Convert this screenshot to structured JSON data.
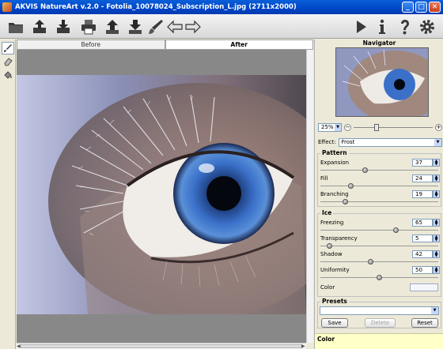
{
  "window": {
    "title": "AKVIS NatureArt v.2.0 - Fotolia_10078024_Subscription_L.jpg (2711x2000)",
    "min_glyph": "_",
    "max_glyph": "□",
    "close_glyph": "✕"
  },
  "toolbar": {
    "left_icons": [
      "open-icon",
      "upload-icon",
      "save-icon",
      "print-icon",
      "share-icon",
      "download-icon",
      "brush-icon",
      "undo-arrow-icon",
      "redo-arrow-icon"
    ],
    "right_icons": [
      "run-icon",
      "info-icon",
      "help-icon",
      "settings-icon"
    ]
  },
  "tools": [
    "brush-tool-icon",
    "eraser-tool-icon",
    "bucket-tool-icon"
  ],
  "tabs": {
    "before": "Before",
    "after": "After"
  },
  "navigator": {
    "title": "Navigator",
    "zoom": "25%",
    "zoom_out": "−",
    "zoom_in": "+",
    "zoom_level": 0.25
  },
  "effect": {
    "label": "Effect:",
    "value": "Frost"
  },
  "pattern": {
    "title": "Pattern",
    "params": [
      {
        "label": "Expansion",
        "value": "37",
        "fraction": 0.37
      },
      {
        "label": "Fill",
        "value": "24",
        "fraction": 0.24
      },
      {
        "label": "Branching",
        "value": "19",
        "fraction": 0.19
      }
    ]
  },
  "ice": {
    "title": "Ice",
    "params": [
      {
        "label": "Freezing",
        "value": "65",
        "fraction": 0.65
      },
      {
        "label": "Transparency",
        "value": "5",
        "fraction": 0.05
      },
      {
        "label": "Shadow",
        "value": "42",
        "fraction": 0.42
      },
      {
        "label": "Uniformity",
        "value": "50",
        "fraction": 0.5
      }
    ],
    "color_label": "Color",
    "color_value": "#f4f6fc"
  },
  "presets": {
    "title": "Presets",
    "save": "Save",
    "delete": "Delete",
    "reset": "Reset"
  },
  "hint": {
    "title": "Color"
  }
}
